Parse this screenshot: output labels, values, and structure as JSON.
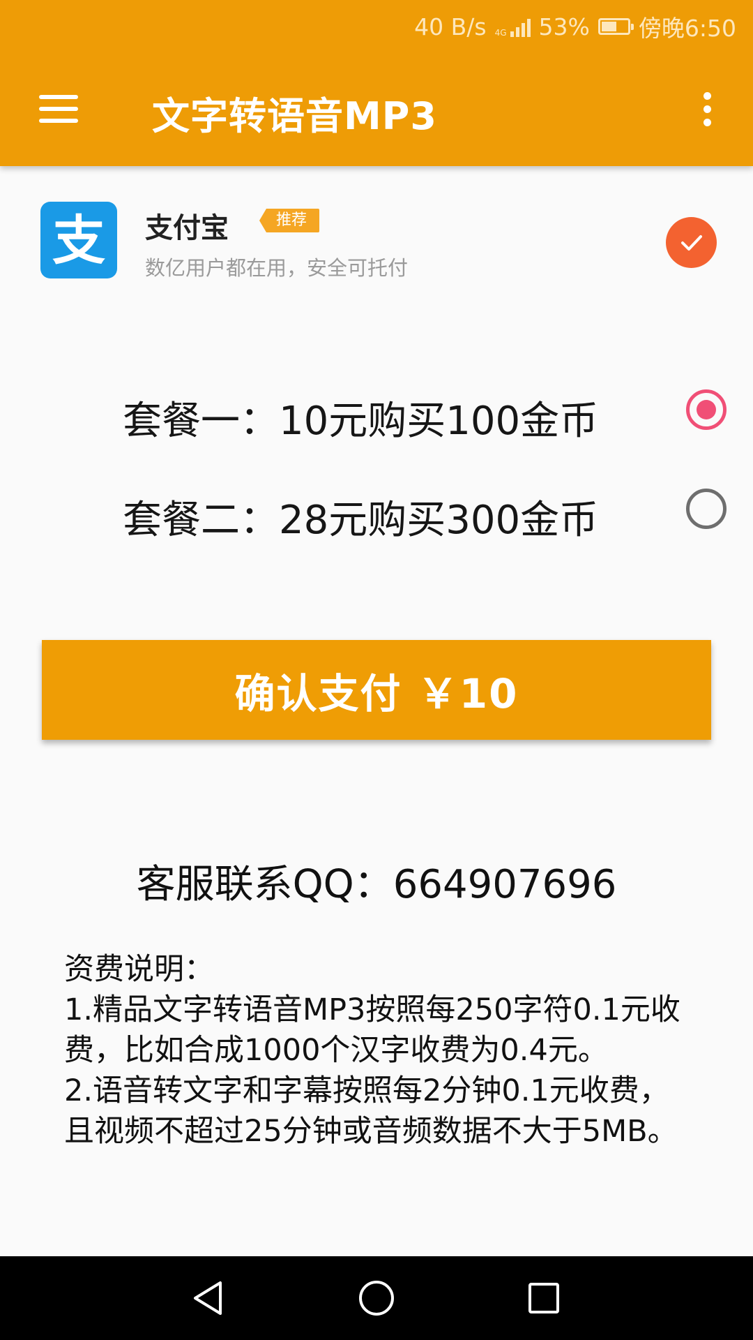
{
  "status_bar": {
    "net_speed": "40 B/s",
    "signal_label": "4G",
    "battery_percent": "53%",
    "battery_level": 0.53,
    "time": "傍晚6:50"
  },
  "app_bar": {
    "title": "文字转语音MP3",
    "menu_icon": "hamburger-menu-icon",
    "overflow_icon": "more-vert-icon",
    "background_color": "#ee9c06"
  },
  "payment_method": {
    "name": "支付宝",
    "badge": "推荐",
    "description": "数亿用户都在用，安全可托付",
    "logo_glyph": "支",
    "logo_color": "#1a9ae6",
    "selected": true,
    "check_color": "#f36230"
  },
  "packages": [
    {
      "label": "套餐一：10元购买100金币",
      "selected": true
    },
    {
      "label": "套餐二：28元购买300金币",
      "selected": false
    }
  ],
  "confirm_button": {
    "label": "确认支付 ￥10",
    "color": "#ef9d05"
  },
  "service_contact": "客服联系QQ：664907696",
  "fees": {
    "title": "资费说明：",
    "items": [
      "1.精品文字转语音MP3按照每250字符0.1元收费，比如合成1000个汉字收费为0.4元。",
      "2.语音转文字和字幕按照每2分钟0.1元收费，且视频不超过25分钟或音频数据不大于5MB。"
    ]
  },
  "nav_bar": {
    "back_icon": "back-triangle-icon",
    "home_icon": "home-circle-icon",
    "recents_icon": "recents-square-icon"
  }
}
